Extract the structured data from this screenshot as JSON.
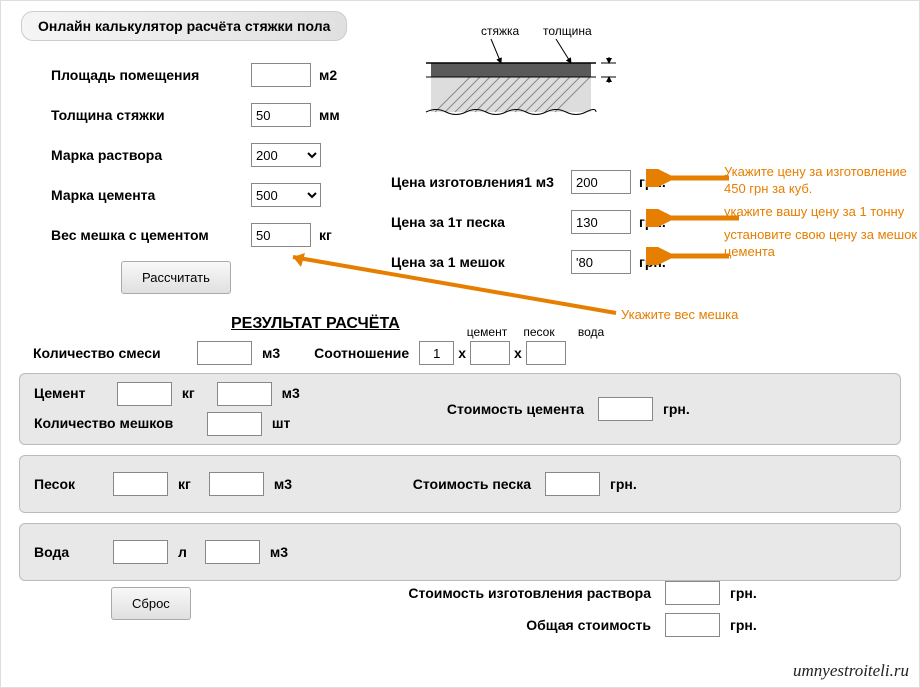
{
  "title": "Онлайн калькулятор расчёта стяжки пола",
  "diagram": {
    "screed_label": "стяжка",
    "thickness_label": "толщина"
  },
  "inputs": {
    "area_label": "Площадь помещения",
    "area_value": "",
    "area_unit": "м2",
    "thickness_label": "Толщина стяжки",
    "thickness_value": "50",
    "thickness_unit": "мм",
    "mortar_grade_label": "Марка раствора",
    "mortar_grade_value": "200",
    "cement_grade_label": "Марка цемента",
    "cement_grade_value": "500",
    "bag_weight_label": "Вес мешка с цементом",
    "bag_weight_value": "50",
    "bag_weight_unit": "кг",
    "price_make_label": "Цена изготовления1 м3",
    "price_make_value": "200",
    "price_make_unit": "грн.",
    "price_sand_label": "Цена за 1т песка",
    "price_sand_value": "130",
    "price_sand_unit": "грн.",
    "price_bag_label": "Цена за 1 мешок",
    "price_bag_value": "'80",
    "price_bag_unit": "грн."
  },
  "buttons": {
    "calc": "Рассчитать",
    "reset": "Сброс"
  },
  "annotations": {
    "a1": "Укажите цену за изготовление 450 грн за куб.",
    "a2": "укажите вашу цену за 1 тонну",
    "a3": "установите свою цену за мешок цемента",
    "a4": "Укажите вес мешка"
  },
  "results_title": "РЕЗУЛЬТАТ РАСЧЁТА",
  "results": {
    "mix_qty_label": "Количество смеси",
    "mix_qty_unit": "м3",
    "ratio_label": "Соотношение",
    "ratio_heads": {
      "cement": "цемент",
      "sand": "песок",
      "water": "вода"
    },
    "ratio_value": "1",
    "ratio_x": "x",
    "cement_label": "Цемент",
    "kg": "кг",
    "m3": "м3",
    "bags_label": "Количество мешков",
    "pcs": "шт",
    "cement_cost_label": "Стоимость цемента",
    "grn": "грн.",
    "sand_label": "Песок",
    "sand_cost_label": "Стоимость песка",
    "water_label": "Вода",
    "l": "л",
    "mortar_cost_label": "Стоимость изготовления раствора",
    "total_label": "Общая стоимость"
  },
  "watermark": "umnyestroiteli.ru"
}
